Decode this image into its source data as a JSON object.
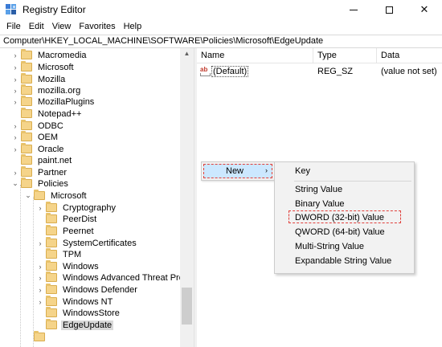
{
  "window": {
    "title": "Registry Editor",
    "app_icon": "registry-editor-icon",
    "controls": {
      "minimize": "minimize-icon",
      "maximize": "maximize-icon",
      "close": "close-icon",
      "close_glyph": "✕"
    }
  },
  "menu": {
    "file": "File",
    "edit": "Edit",
    "view": "View",
    "favorites": "Favorites",
    "help": "Help"
  },
  "address": "Computer\\HKEY_LOCAL_MACHINE\\SOFTWARE\\Policies\\Microsoft\\EdgeUpdate",
  "tree": [
    {
      "label": "Macromedia",
      "expander": "›"
    },
    {
      "label": "Microsoft",
      "expander": "›"
    },
    {
      "label": "Mozilla",
      "expander": "›"
    },
    {
      "label": "mozilla.org",
      "expander": "›"
    },
    {
      "label": "MozillaPlugins",
      "expander": "›"
    },
    {
      "label": "Notepad++",
      "expander": ""
    },
    {
      "label": "ODBC",
      "expander": "›"
    },
    {
      "label": "OEM",
      "expander": "›"
    },
    {
      "label": "Oracle",
      "expander": "›"
    },
    {
      "label": "paint.net",
      "expander": ""
    },
    {
      "label": "Partner",
      "expander": "›"
    },
    {
      "label": "Policies",
      "expander": "⌄"
    },
    {
      "label": "Microsoft",
      "expander": "⌄"
    },
    {
      "label": "Cryptography",
      "expander": "›"
    },
    {
      "label": "PeerDist",
      "expander": ""
    },
    {
      "label": "Peernet",
      "expander": ""
    },
    {
      "label": "SystemCertificates",
      "expander": "›"
    },
    {
      "label": "TPM",
      "expander": ""
    },
    {
      "label": "Windows",
      "expander": "›"
    },
    {
      "label": "Windows Advanced Threat Protecti",
      "expander": "›"
    },
    {
      "label": "Windows Defender",
      "expander": "›"
    },
    {
      "label": "Windows NT",
      "expander": "›"
    },
    {
      "label": "WindowsStore",
      "expander": ""
    },
    {
      "label": "EdgeUpdate",
      "expander": "",
      "selected": true
    }
  ],
  "list": {
    "columns": {
      "name": "Name",
      "type": "Type",
      "data": "Data"
    },
    "rows": [
      {
        "icon": "ab",
        "name": "(Default)",
        "type": "REG_SZ",
        "data": "(value not set)"
      }
    ]
  },
  "context_menu": {
    "new_label": "New",
    "new_arrow": "›",
    "submenu": [
      {
        "label": "Key"
      },
      {
        "label": "String Value"
      },
      {
        "label": "Binary Value"
      },
      {
        "label": "DWORD (32-bit) Value",
        "highlighted": true
      },
      {
        "label": "QWORD (64-bit) Value"
      },
      {
        "label": "Multi-String Value"
      },
      {
        "label": "Expandable String Value"
      }
    ]
  },
  "colors": {
    "highlight_dashed": "#e0403b",
    "selection": "#cce8ff"
  }
}
